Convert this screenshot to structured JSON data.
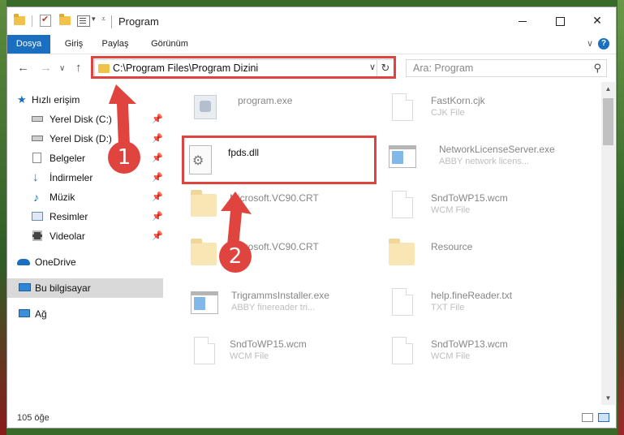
{
  "window": {
    "title": "Program"
  },
  "ribbon": {
    "tabs": [
      "Dosya",
      "Giriş",
      "Paylaş",
      "Görünüm"
    ]
  },
  "address": {
    "path": "C:\\Program Files\\Program Dizini"
  },
  "search": {
    "placeholder": "Ara: Program"
  },
  "sidebar": {
    "items": [
      {
        "label": "Hızlı erişim",
        "icon": "star-icon",
        "pinned": false
      },
      {
        "label": "Yerel Disk (C:)",
        "icon": "drive-icon",
        "pinned": true
      },
      {
        "label": "Yerel Disk (D:)",
        "icon": "drive-icon",
        "pinned": true
      },
      {
        "label": "Belgeler",
        "icon": "documents-icon",
        "pinned": true
      },
      {
        "label": "İndirmeler",
        "icon": "download-icon",
        "pinned": true
      },
      {
        "label": "Müzik",
        "icon": "music-icon",
        "pinned": true
      },
      {
        "label": "Resimler",
        "icon": "pictures-icon",
        "pinned": true
      },
      {
        "label": "Videolar",
        "icon": "video-icon",
        "pinned": true
      },
      {
        "label": "OneDrive",
        "icon": "cloud-icon",
        "pinned": false
      },
      {
        "label": "Bu bilgisayar",
        "icon": "computer-icon",
        "pinned": false,
        "selected": true
      },
      {
        "label": "Ağ",
        "icon": "network-icon",
        "pinned": false
      }
    ]
  },
  "files": [
    {
      "name": "program.exe",
      "sub": "",
      "icon": "exe-icon"
    },
    {
      "name": "FastKorn.cjk",
      "sub": "CJK File",
      "icon": "file-icon"
    },
    {
      "name": "fpds.dll",
      "sub": "",
      "icon": "dll-gear-icon"
    },
    {
      "name": "NetworkLicenseServer.exe",
      "sub": "ABBY network licens...",
      "icon": "app-icon"
    },
    {
      "name": "Microsoft.VC90.CRT",
      "sub": "",
      "icon": "folder-icon"
    },
    {
      "name": "SndToWP15.wcm",
      "sub": "WCM File",
      "icon": "file-icon"
    },
    {
      "name": "Microsoft.VC90.CRT",
      "sub": "",
      "icon": "folder-icon"
    },
    {
      "name": "Resource",
      "sub": "",
      "icon": "folder-icon"
    },
    {
      "name": "TrigrammsInstaller.exe",
      "sub": "ABBY finereader tri...",
      "icon": "app-icon"
    },
    {
      "name": "help.fineReader.txt",
      "sub": "TXT File",
      "icon": "file-icon"
    },
    {
      "name": "SndToWP15.wcm",
      "sub": "WCM File",
      "icon": "file-icon"
    },
    {
      "name": "SndToWP13.wcm",
      "sub": "WCM File",
      "icon": "file-icon"
    }
  ],
  "status": {
    "count": "105 öğe"
  },
  "annotations": {
    "badge1": "1",
    "badge2": "2",
    "color": "#e0443e"
  }
}
